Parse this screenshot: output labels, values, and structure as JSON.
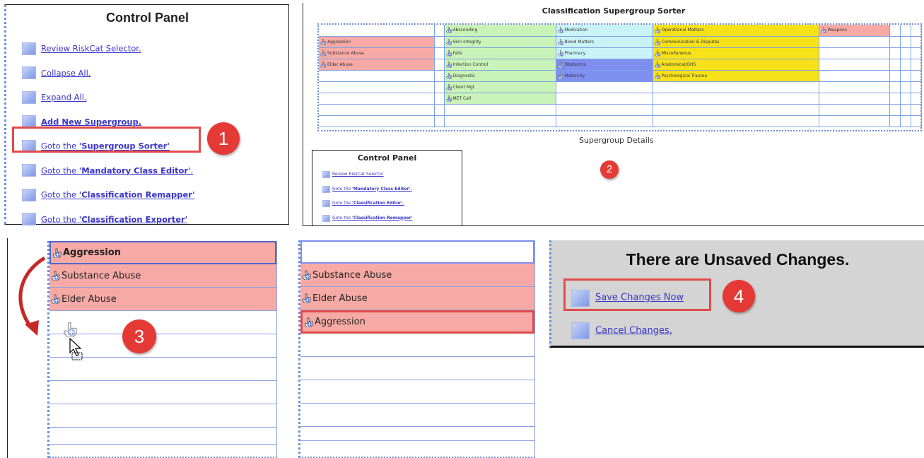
{
  "panel1": {
    "title": "Control Panel",
    "items": [
      "Review RiskCat Selector.",
      "Collapse All.",
      "Expand All."
    ],
    "add_label": "Add New Supergroup.",
    "goto_prefix": "Goto the ",
    "goto_items": [
      "'Supergroup Sorter'",
      "'Mandatory Class Editor'",
      "'Classification Remapper'",
      "'Classification Exporter'"
    ],
    "goto_suffix_1": "."
  },
  "sorter": {
    "title": "Classification Supergroup Sorter",
    "details": "Supergroup Details",
    "col_red": [
      "Aggression",
      "Substance Abuse",
      "Elder Abuse"
    ],
    "col_green": [
      "Absconding",
      "Skin Integrity",
      "Falls",
      "Infection Control",
      "Diagnostic",
      "Client Mgt",
      "MET Call"
    ],
    "col_cyan": [
      "Medication",
      "Blood Matters",
      "Pharmacy",
      "Obstetrics",
      "Maternity"
    ],
    "col_yellow": [
      "Operational Matters",
      "Communication & Disputes",
      "Miscellaneous",
      "Anatomical/OHS",
      "Psychological Trauma"
    ],
    "col_weapons": [
      "Weapons"
    ]
  },
  "panel2": {
    "title": "Control Panel",
    "review": "Review RiskCat Selector",
    "goto_prefix": "Goto the ",
    "items": [
      "'Mandatory Class Editor'.",
      "'Classification Editor'.",
      "'Classification Remapper'"
    ]
  },
  "list3": [
    "Aggression",
    "Substance Abuse",
    "Elder Abuse"
  ],
  "list3b": [
    "Substance Abuse",
    "Elder Abuse",
    "Aggression"
  ],
  "unsaved": {
    "title": "There are Unsaved Changes.",
    "save": "Save Changes Now",
    "cancel": "Cancel Changes."
  },
  "badges": [
    "1",
    "2",
    "3",
    "4"
  ],
  "colors": {
    "red_fill": "#f7aaa5",
    "green_fill": "#c9f3b8",
    "cyan_fill": "#c9f3f7",
    "yellow_fill": "#f7e21a",
    "blue_fill": "#7f8ff0",
    "badge": "#e53935",
    "link": "#3a35c9"
  }
}
